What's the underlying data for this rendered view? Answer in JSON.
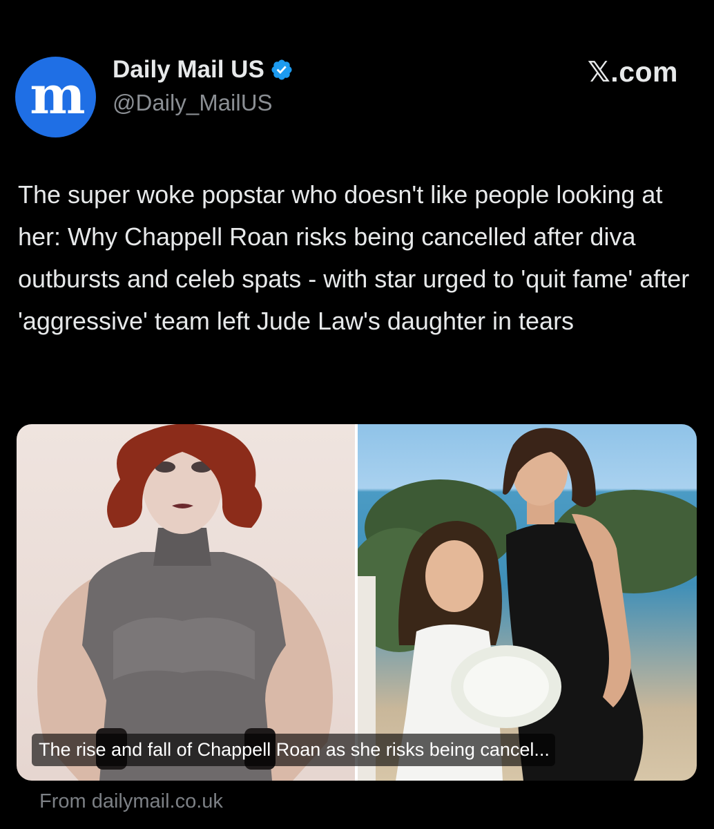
{
  "account": {
    "display_name": "Daily Mail US",
    "handle": "@Daily_MailUS",
    "avatar_letter": "m",
    "verified": true,
    "avatar_color": "#1f6fe5",
    "verified_color": "#1d9bf0"
  },
  "source_site": "𝕏.com",
  "tweet": {
    "text": "The super woke popstar who doesn't like people looking at her: Why Chappell Roan risks being cancelled after diva outbursts and celeb spats - with star urged to 'quit fame' after 'aggressive' team left Jude Law's daughter in tears"
  },
  "link_card": {
    "caption": "The rise and fall of Chappell Roan as she risks being cancel...",
    "from_text": "From dailymail.co.uk"
  }
}
